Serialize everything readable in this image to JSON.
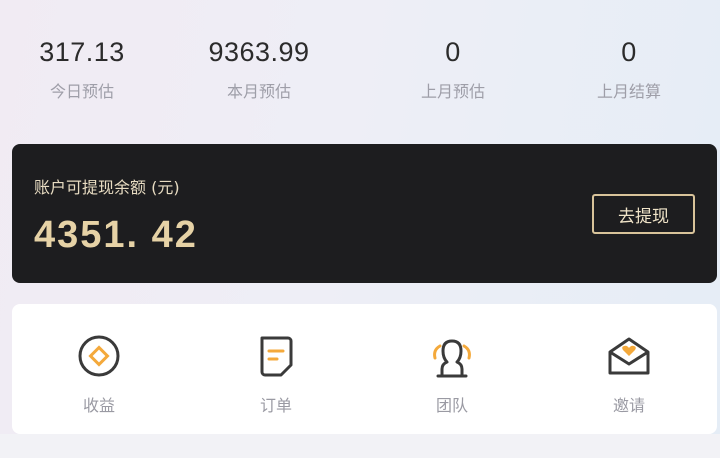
{
  "stats": [
    {
      "value": "317.13",
      "label": "今日预估"
    },
    {
      "value": "9363.99",
      "label": "本月预估"
    },
    {
      "value": "0",
      "label": "上月预估"
    },
    {
      "value": "0",
      "label": "上月结算"
    }
  ],
  "balance": {
    "title": "账户可提现余额 (元)",
    "amount": "4351. 42",
    "withdraw_label": "去提现"
  },
  "menu": [
    {
      "label": "收益",
      "icon": "earnings-icon"
    },
    {
      "label": "订单",
      "icon": "order-icon"
    },
    {
      "label": "团队",
      "icon": "team-icon"
    },
    {
      "label": "邀请",
      "icon": "invite-icon"
    }
  ],
  "colors": {
    "gold": "#e6d2a6",
    "accent_orange": "#f4a93b",
    "icon_dark": "#3a3a3a",
    "card_bg": "#1d1d1f"
  }
}
